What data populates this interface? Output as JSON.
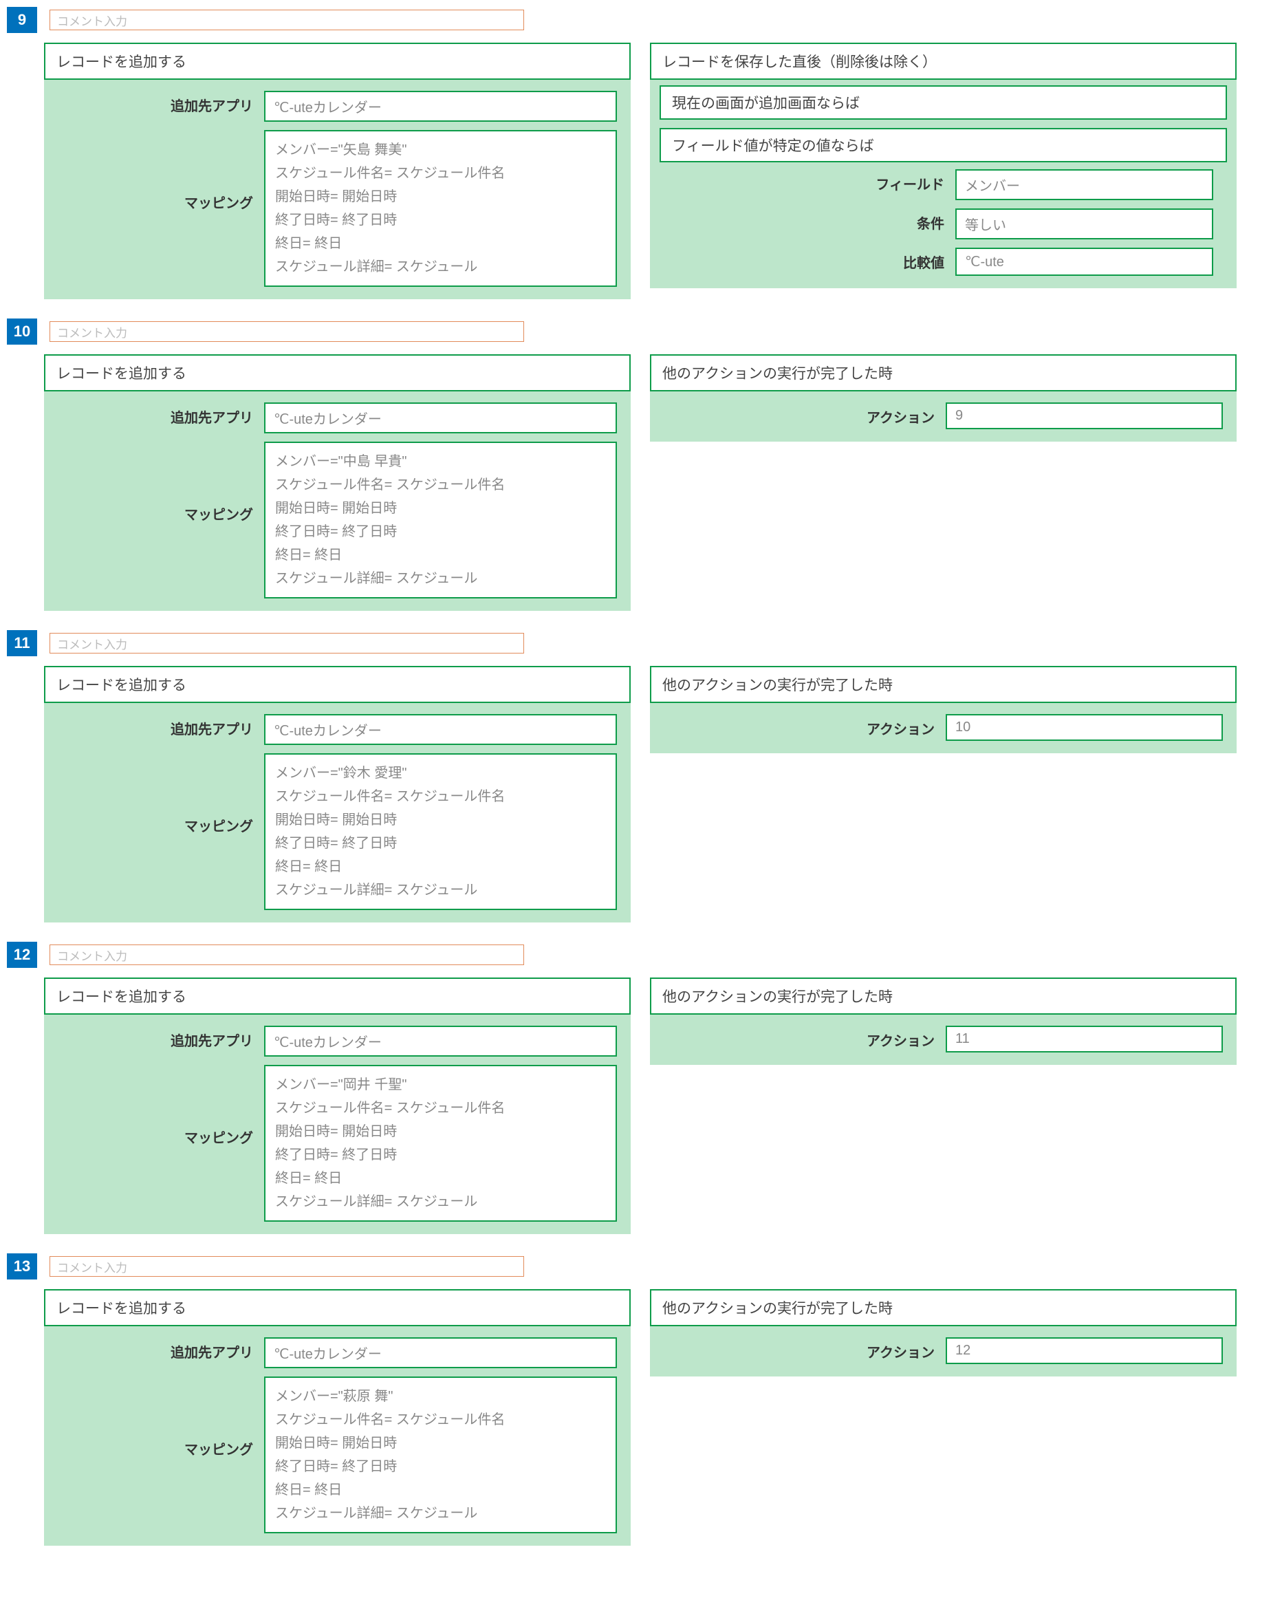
{
  "comment_placeholder": "コメント入力",
  "labels": {
    "add_app": "追加先アプリ",
    "mapping": "マッピング",
    "field": "フィールド",
    "condition": "条件",
    "compare": "比較値",
    "action": "アクション"
  },
  "rules": [
    {
      "number": "9",
      "action_title": "レコードを追加する",
      "add_app": "℃-uteカレンダー",
      "mapping": "メンバー=\"矢島 舞美\"\nスケジュール件名= スケジュール件名\n開始日時= 開始日時\n終了日時= 終了日時\n終日= 終日\nスケジュール詳細= スケジュール",
      "condition_type": "save",
      "cond_title1": "レコードを保存した直後（削除後は除く）",
      "cond_title2": "現在の画面が追加画面ならば",
      "cond_title3": "フィールド値が特定の値ならば",
      "cond_field": "メンバー",
      "cond_op": "等しい",
      "cond_value": "℃-ute"
    },
    {
      "number": "10",
      "action_title": "レコードを追加する",
      "add_app": "℃-uteカレンダー",
      "mapping": "メンバー=\"中島 早貴\"\nスケジュール件名= スケジュール件名\n開始日時= 開始日時\n終了日時= 終了日時\n終日= 終日\nスケジュール詳細= スケジュール",
      "condition_type": "after_action",
      "cond_title1": "他のアクションの実行が完了した時",
      "cond_action": "9"
    },
    {
      "number": "11",
      "action_title": "レコードを追加する",
      "add_app": "℃-uteカレンダー",
      "mapping": "メンバー=\"鈴木 愛理\"\nスケジュール件名= スケジュール件名\n開始日時= 開始日時\n終了日時= 終了日時\n終日= 終日\nスケジュール詳細= スケジュール",
      "condition_type": "after_action",
      "cond_title1": "他のアクションの実行が完了した時",
      "cond_action": "10"
    },
    {
      "number": "12",
      "action_title": "レコードを追加する",
      "add_app": "℃-uteカレンダー",
      "mapping": "メンバー=\"岡井 千聖\"\nスケジュール件名= スケジュール件名\n開始日時= 開始日時\n終了日時= 終了日時\n終日= 終日\nスケジュール詳細= スケジュール",
      "condition_type": "after_action",
      "cond_title1": "他のアクションの実行が完了した時",
      "cond_action": "11"
    },
    {
      "number": "13",
      "action_title": "レコードを追加する",
      "add_app": "℃-uteカレンダー",
      "mapping": "メンバー=\"萩原 舞\"\nスケジュール件名= スケジュール件名\n開始日時= 開始日時\n終了日時= 終了日時\n終日= 終日\nスケジュール詳細= スケジュール",
      "condition_type": "after_action",
      "cond_title1": "他のアクションの実行が完了した時",
      "cond_action": "12"
    }
  ]
}
